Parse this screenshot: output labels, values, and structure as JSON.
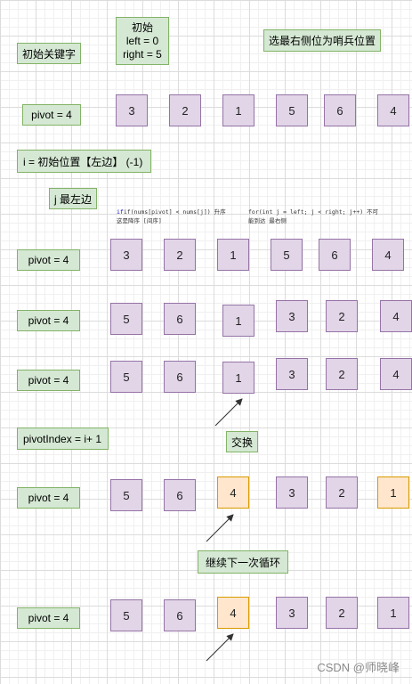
{
  "labels": {
    "init_key": "初始关键字",
    "init_title": "初始",
    "init_left": "left = 0",
    "init_right": "right = 5",
    "sentinel": "选最右侧位为哨兵位置",
    "pivot": "pivot =  4",
    "i_init": "i = 初始位置【左边】 (-1)",
    "j_left": "j 最左边",
    "pivot_index": "pivotIndex = i+ 1",
    "swap": "交换",
    "continue": "继续下一次循环"
  },
  "code": {
    "line1_a": "if(nums[pivot] < nums[j]) 升序",
    "line1_b": "for(int j = left; j < right; j++) 不可",
    "line2_a": "这是降序 [间序]",
    "line2_b": "能到达 最右侧"
  },
  "rows": {
    "row1": [
      "3",
      "2",
      "1",
      "5",
      "6",
      "4"
    ],
    "row2": [
      "3",
      "2",
      "1",
      "5",
      "6",
      "4"
    ],
    "row3": [
      "5",
      "6",
      "1",
      "3",
      "2",
      "4"
    ],
    "row4": [
      "5",
      "6",
      "1",
      "3",
      "2",
      "4"
    ],
    "row5": [
      "5",
      "6",
      "4",
      "3",
      "2",
      "1"
    ],
    "row6": [
      "5",
      "6",
      "4",
      "3",
      "2",
      "1"
    ]
  },
  "watermark": "CSDN @师晓峰",
  "colors": {
    "green_fill": "#d5e8d4",
    "green_border": "#82b366",
    "purple_fill": "#e1d5e7",
    "purple_border": "#9673a6",
    "orange_fill": "#ffe6cc",
    "orange_border": "#d79b00"
  }
}
